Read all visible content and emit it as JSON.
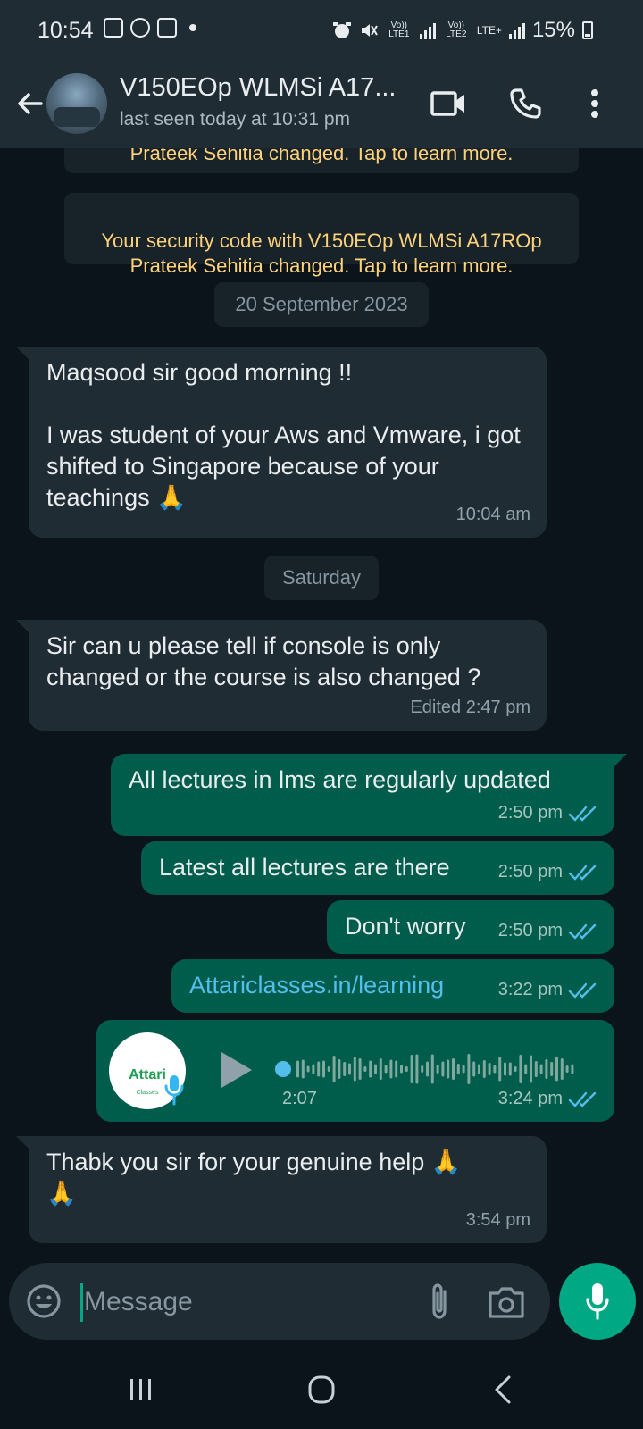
{
  "status_bar": {
    "time": "10:54",
    "sim1_label": "Vo)) LTE1",
    "sim2_label": "Vo)) LTE2",
    "lte_label": "LTE+",
    "battery": "15%"
  },
  "header": {
    "contact_name": "V150EOp WLMSi A17...",
    "status": "last seen today at 10:31 pm"
  },
  "messages": {
    "sys1": "Prateek Sehitia changed. Tap to learn more.",
    "sys2": "Your security code with V150EOp WLMSi A17ROp\nPrateek Sehitia changed. Tap to learn more.",
    "date1": "20 September 2023",
    "m1_text": "Maqsood sir good morning !!\n\nI was student of your Aws and Vmware, i got shifted to Singapore because of your teachings 🙏",
    "m1_time": "10:04 am",
    "date2": "Saturday",
    "m2_text": "Sir can u please tell if console is only changed or the course is also changed ?",
    "m2_time": "Edited 2:47 pm",
    "m3_text": "All lectures in lms are regularly updated",
    "m3_time": "2:50 pm",
    "m4_text": "Latest all lectures are there",
    "m4_time": "2:50 pm",
    "m5_text": "Don't worry",
    "m5_time": "2:50 pm",
    "m6_text": "Attariclasses.in/learning",
    "m6_time": "3:22 pm",
    "voice_logo": "Attari",
    "voice_logo_sub": "Classes",
    "voice_duration": "2:07",
    "voice_time": "3:24 pm",
    "m8_text": "Thabk you sir for your genuine help 🙏\n🙏",
    "m8_time": "3:54 pm"
  },
  "input": {
    "placeholder": "Message",
    "value": ""
  },
  "colors": {
    "background": "#0b141a",
    "header": "#1f2c34",
    "incoming_bubble": "#202c33",
    "outgoing_bubble": "#005c4b",
    "accent": "#00a884",
    "system_text": "#ffd279",
    "link": "#53bdeb",
    "read_ticks": "#53bdeb"
  },
  "icons": {
    "back": "arrow-left-icon",
    "video": "video-call-icon",
    "call": "phone-icon",
    "menu": "more-vert-icon",
    "emoji": "emoji-icon",
    "attach": "paperclip-icon",
    "camera": "camera-icon",
    "mic": "mic-icon",
    "play": "play-icon"
  }
}
